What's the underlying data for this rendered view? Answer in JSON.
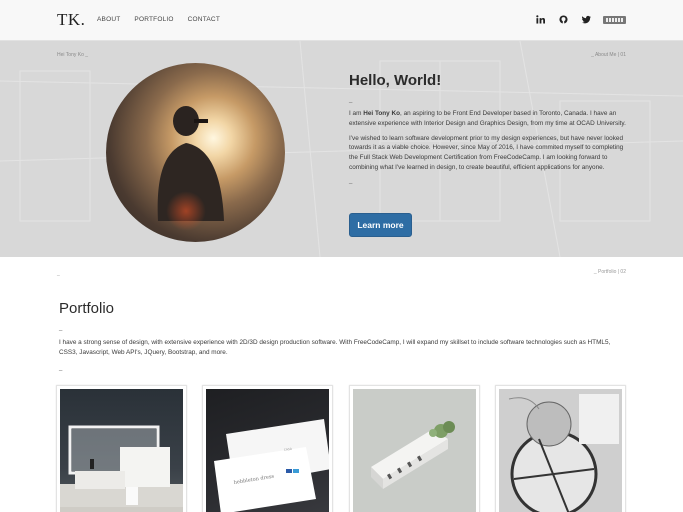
{
  "nav": {
    "logo": "TK.",
    "links": [
      "ABOUT",
      "PORTFOLIO",
      "CONTACT"
    ],
    "social": [
      "linkedin-icon",
      "github-icon",
      "twitter-icon"
    ]
  },
  "about": {
    "crumb_left": "Hei Tony Ko _",
    "crumb_right": "_ About Me | 01",
    "title": "Hello, World!",
    "dash": "_",
    "p1_pre": "I am ",
    "p1_name": "Hei Tony Ko",
    "p1_post": ", an aspiring to be Front End Developer based in Toronto, Canada. I have an extensive experience with Interior Design and Graphics Design, from my time at OCAD University.",
    "p2": "I've wished to learn software development prior to my design experiences, but have never looked towards it as a viable choice. However, since May of 2016, I have commited myself to completing the Full Stack Web Development Certification from FreeCodeCamp. I am looking forward to combining what I've learned in design, to create beautiful, efficient applications for anyone.",
    "dash2": "_",
    "button": "Learn more"
  },
  "portfolio": {
    "crumb_left": "_",
    "crumb_right": "_ Portfolio | 02",
    "title": "Portfolio",
    "dash": "_",
    "description": "I have a strong sense of design, with extensive experience with 2D/3D design production software. With FreeCodeCamp, I will expand my skillset to include software technologies such as HTML5, CSS3, Javascript, Web API's, JQuery, Bootstrap, and more.",
    "dash2": "_"
  }
}
